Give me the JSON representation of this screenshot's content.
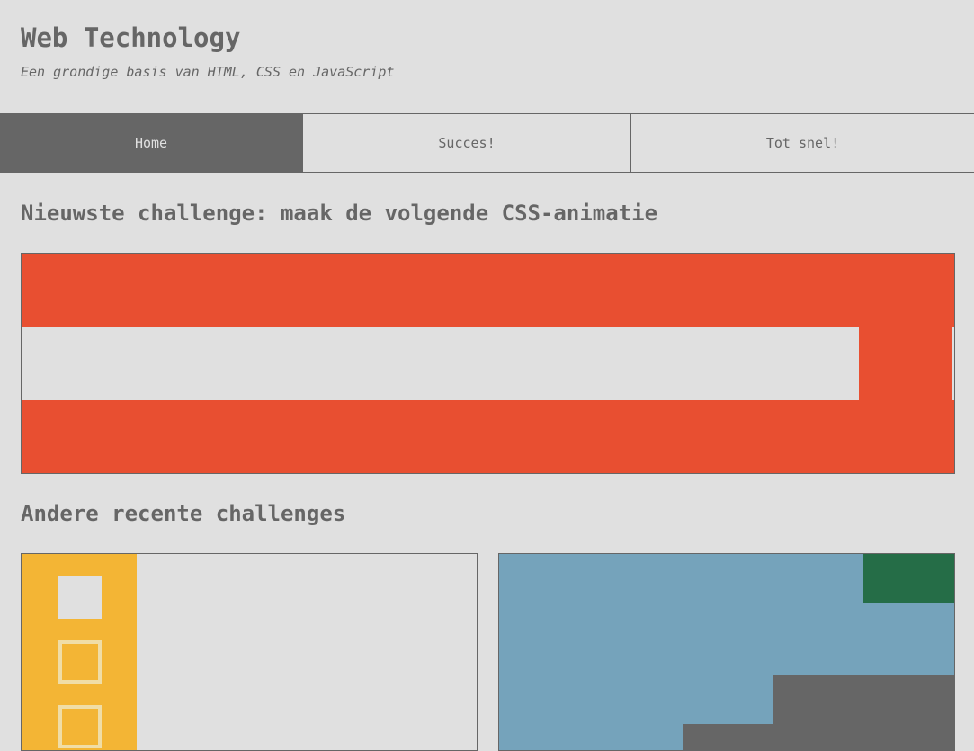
{
  "header": {
    "title": "Web Technology",
    "subtitle": "Een grondige basis van HTML, CSS en JavaScript"
  },
  "nav": {
    "items": [
      {
        "label": "Home",
        "active": true
      },
      {
        "label": "Succes!",
        "active": false
      },
      {
        "label": "Tot snel!",
        "active": false
      }
    ]
  },
  "main": {
    "newest_heading": "Nieuwste challenge: maak de volgende CSS-animatie",
    "others_heading": "Andere recente challenges"
  },
  "colors": {
    "background": "#e0e0e0",
    "text": "#666666",
    "animation_red": "#e84f31",
    "card_yellow": "#f3b535",
    "card_blue": "#75a3bb",
    "card_green": "#256d47"
  }
}
